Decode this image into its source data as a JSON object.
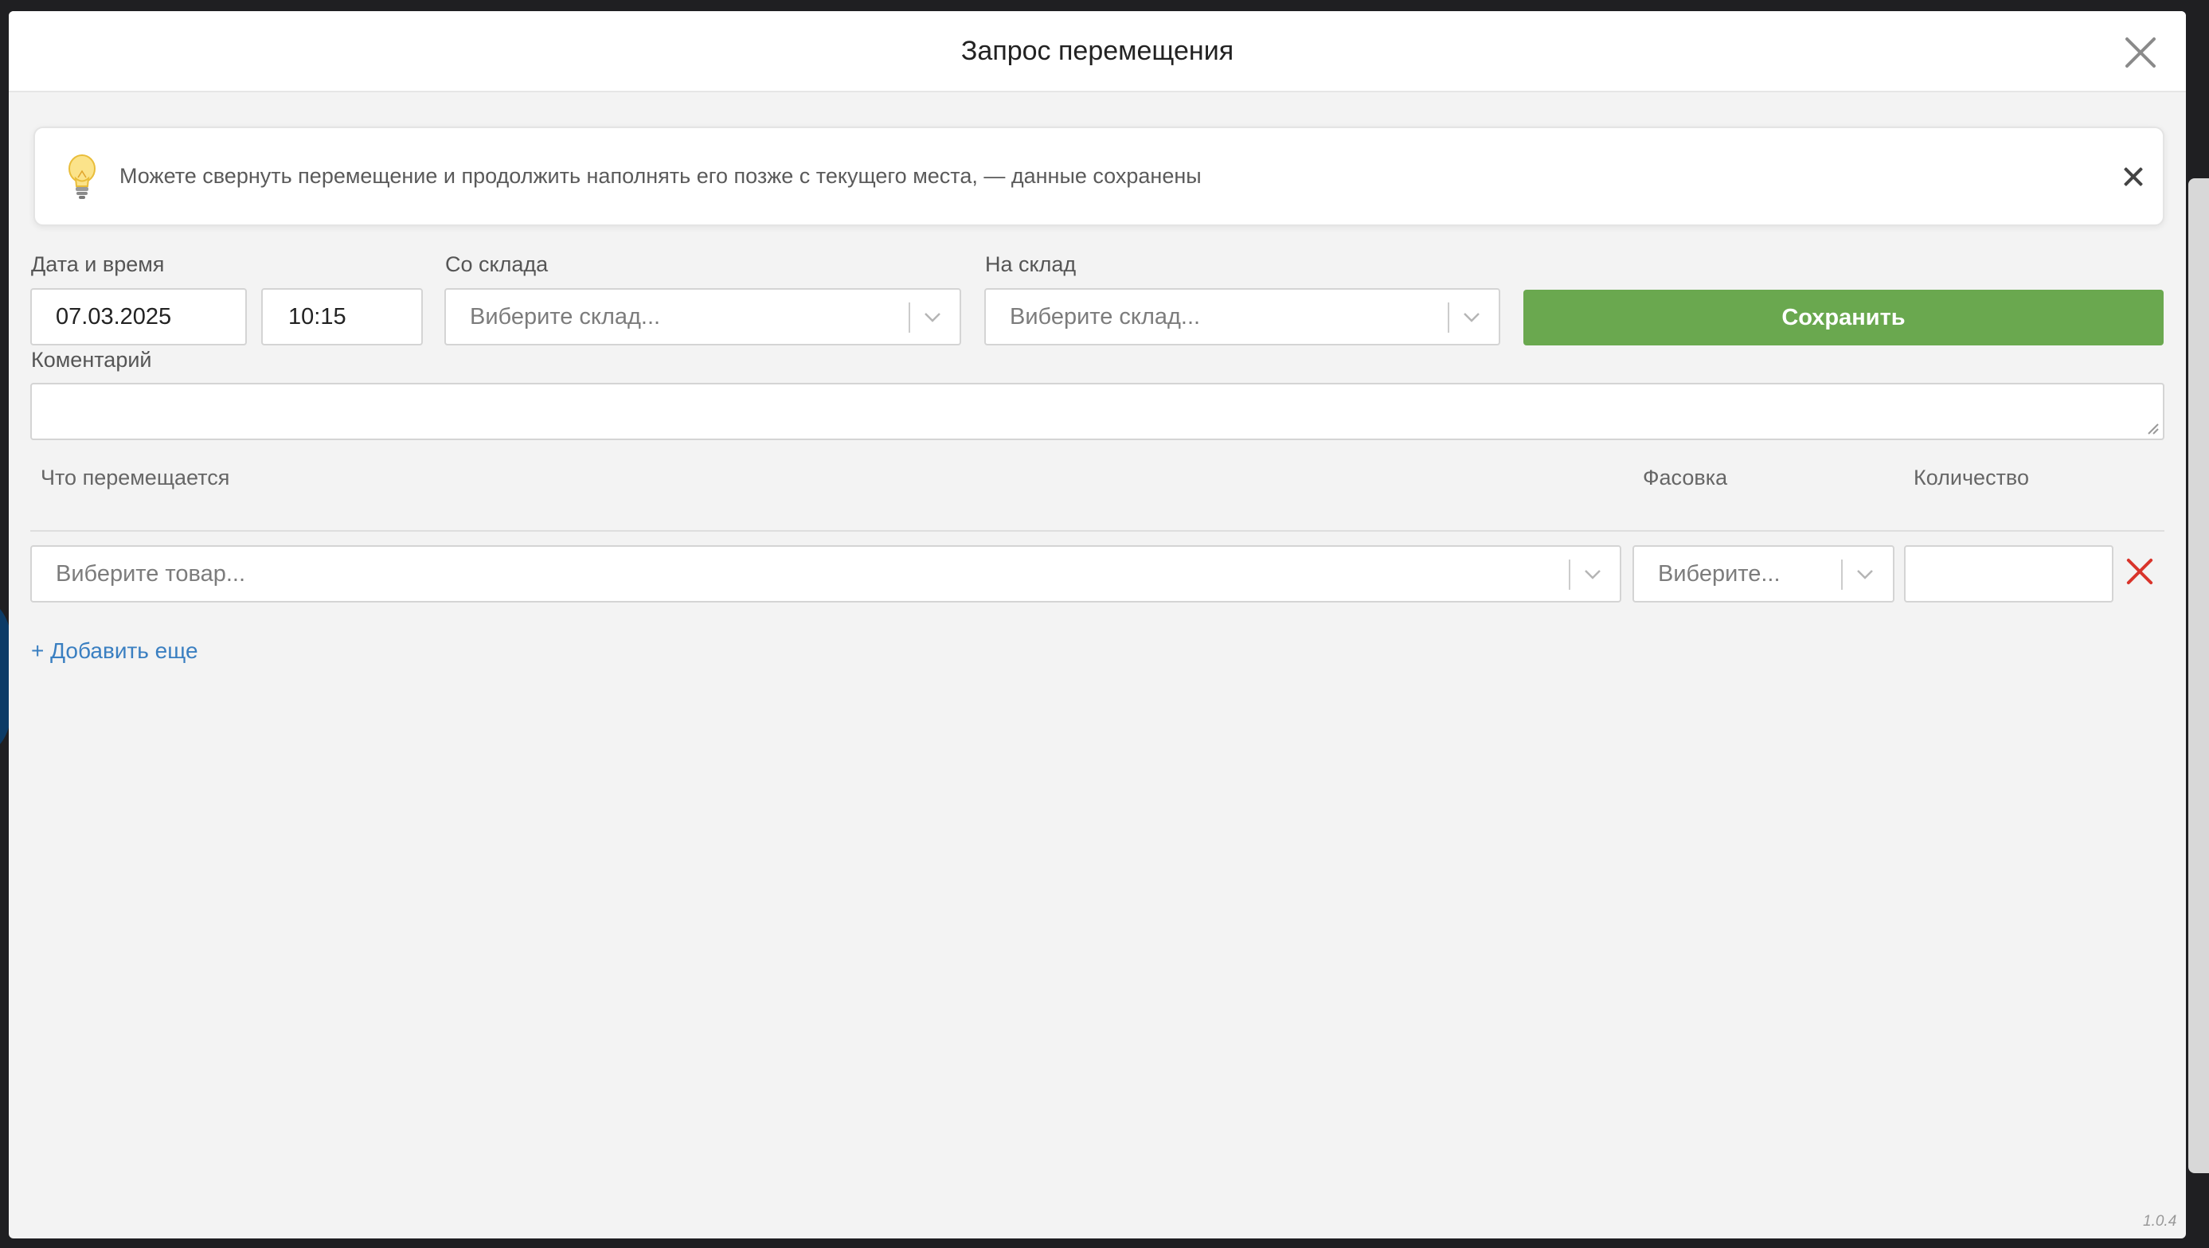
{
  "modal": {
    "title": "Запрос перемещения",
    "close_icon": "close-icon",
    "version": "1.0.4"
  },
  "notice": {
    "icon": "lightbulb-icon",
    "text": "Можете свернуть перемещение и продолжить наполнять его позже с текущего места, — данные сохранены",
    "close_icon": "close-icon"
  },
  "form": {
    "datetime_label": "Дата и время",
    "date_value": "07.03.2025",
    "time_value": "10:15",
    "from_label": "Со склада",
    "from_placeholder": "Виберите склад...",
    "to_label": "На склад",
    "to_placeholder": "Виберите склад...",
    "save_label": "Сохранить",
    "comment_label": "Коментарий",
    "comment_value": ""
  },
  "items": {
    "columns": [
      "Что перемещается",
      "Фасовка",
      "Количество"
    ],
    "rows": [
      {
        "product_placeholder": "Виберите товар...",
        "packaging_placeholder": "Виберите...",
        "quantity_value": ""
      }
    ],
    "add_more_label": "+ Добавить еще"
  },
  "colors": {
    "save_button": "#6aa84f",
    "link": "#3a7fc1",
    "remove": "#d9342b"
  }
}
